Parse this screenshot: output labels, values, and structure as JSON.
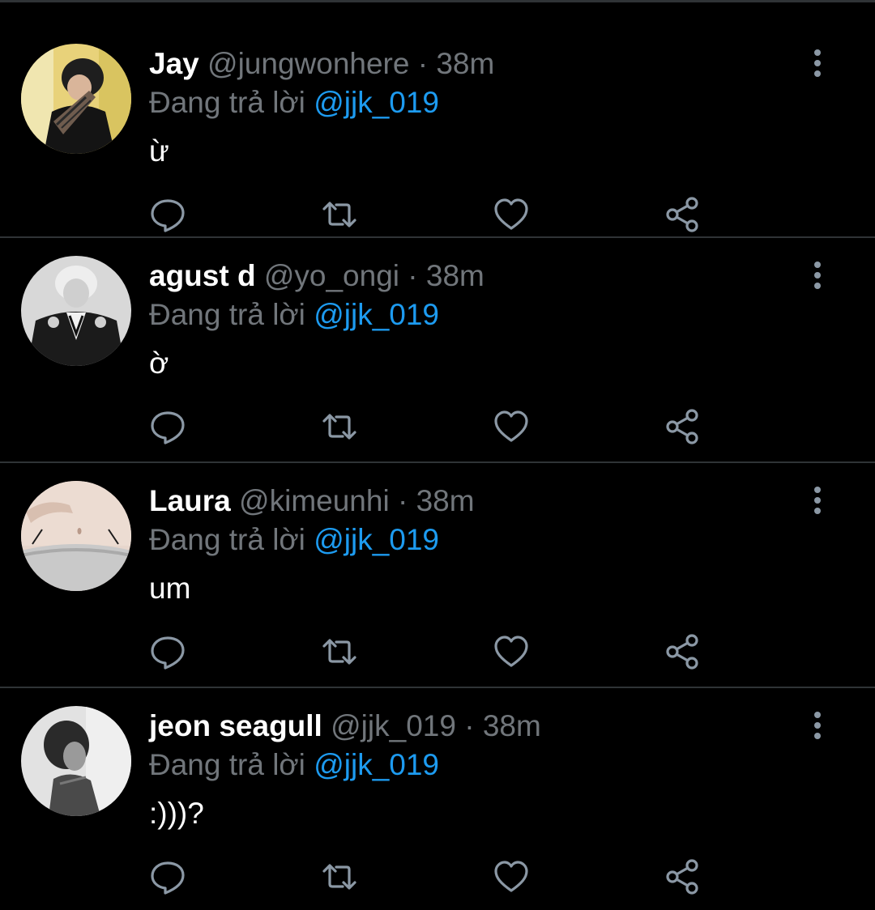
{
  "colors": {
    "background": "#000000",
    "name": "#ffffff",
    "muted": "#71767b",
    "mention": "#1d9bf0",
    "divider": "#2f3336",
    "icon": "#8b98a5"
  },
  "tweets": [
    {
      "name": "Jay",
      "handle": "@jungwonhere",
      "separator": "·",
      "time": "38m",
      "reply_prefix": "Đang trả lời",
      "reply_to": "@jjk_019",
      "text": "ừ",
      "avatar_icon": "user-avatar-jay"
    },
    {
      "name": "agust d",
      "handle": "@yo_ongi",
      "separator": "·",
      "time": "38m",
      "reply_prefix": "Đang trả lời",
      "reply_to": "@jjk_019",
      "text": "ờ",
      "avatar_icon": "user-avatar-agust-d"
    },
    {
      "name": "Laura",
      "handle": "@kimeunhi",
      "separator": "·",
      "time": "38m",
      "reply_prefix": "Đang trả lời",
      "reply_to": "@jjk_019",
      "text": "um",
      "avatar_icon": "user-avatar-laura"
    },
    {
      "name": "jeon seagull",
      "handle": "@jjk_019",
      "separator": "·",
      "time": "38m",
      "reply_prefix": "Đang trả lời",
      "reply_to": "@jjk_019",
      "text": ":)))?",
      "avatar_icon": "user-avatar-jeon-seagull"
    }
  ],
  "action_icons": [
    "reply-icon",
    "retweet-icon",
    "like-icon",
    "share-icon"
  ],
  "more_icon": "more-options-icon"
}
